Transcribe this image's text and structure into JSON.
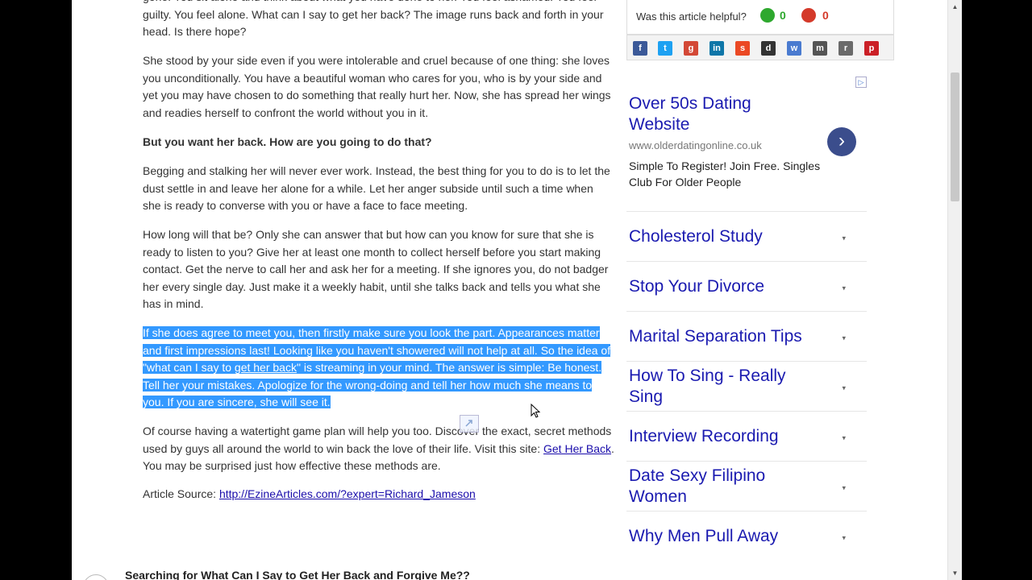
{
  "article": {
    "top_text": "gone. You sit alone and think about what you have done to her. You feel ashamed. You feel guilty. You feel alone. What can I say to get her back? The image runs back and forth in your head. Is there hope?",
    "p1": "She stood by your side even if you were intolerable and cruel because of one thing: she loves you unconditionally. You have a beautiful woman who cares for you, who is by your side and yet you may have chosen to do something that really hurt her. Now, she has spread her wings and readies herself to confront the world without you in it.",
    "p2": "But you want her back. How are you going to do that?",
    "p3": "Begging and stalking her will never ever work. Instead, the best thing for you to do is to let the dust settle in and leave her alone for a while. Let her anger subside until such a time when she is ready to converse with you or have a face to face meeting.",
    "p4": "How long will that be? Only she can answer that but how can you know for sure that she is ready to listen to you? Give her at least one month to collect herself before you start making contact. Get the nerve to call her and ask her for a meeting. If she ignores you, do not badger her every single day. Just make it a weekly habit, until she talks back and tells you what she has in mind.",
    "p5_part1": "If she does agree to meet you, then firstly make sure you look the part. Appearances matter and first impressions last! Looking like you haven't showered will not help at all. So the idea of \"what can I say to ",
    "p5_link": "get her back",
    "p5_part2": "\" is streaming in your mind. The answer is simple: Be honest. Tell her your mistakes. Apologize for the wrong-doing and tell her how much she means to you. If you are sincere, she will see it.",
    "p6_part1": "Of course having a watertight game plan will help you too. Discover the exact, secret methods used by guys all around the world to win back the love of their life. Visit this site: ",
    "p6_link": "Get Her Back",
    "p6_part2": ". You may be surprised just how effective these methods are.",
    "source_label": "Article Source: ",
    "source_link": "http://EzineArticles.com/?expert=Richard_Jameson"
  },
  "helpful": {
    "question": "Was this article helpful?",
    "up_count": "0",
    "down_count": "0"
  },
  "share_icons": [
    "facebook-icon",
    "twitter-icon",
    "googleplus-icon",
    "linkedin-icon",
    "stumbleupon-icon",
    "delicious-icon",
    "digg-icon",
    "myspace-icon",
    "reddit-icon",
    "pinterest-icon"
  ],
  "ad": {
    "title": "Over 50s Dating Website",
    "url": "www.olderdatingonline.co.uk",
    "desc": "Simple To Register! Join Free. Singles Club For Older People"
  },
  "sidebar_links": [
    "Cholesterol Study",
    "Stop Your Divorce",
    "Marital Separation Tips",
    "How To Sing - Really Sing",
    "Interview Recording",
    "Date Sexy Filipino Women",
    "Why Men Pull Away"
  ],
  "bottom": {
    "title": "Searching for What Can I Say to Get Her Back and Forgive Me??"
  },
  "colors": {
    "link_blue": "#1a1ab0",
    "selection": "#3399ff",
    "up": "#2ea82e",
    "down": "#d43a2a"
  }
}
